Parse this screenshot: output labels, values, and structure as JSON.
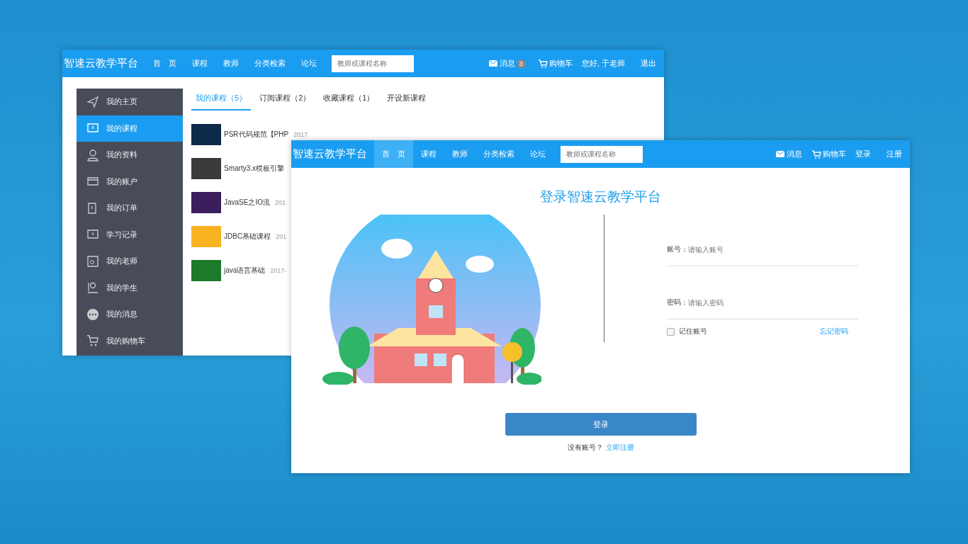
{
  "back_window": {
    "logo": "智速云教学平台",
    "nav": [
      {
        "label": "首　页",
        "selected": false
      },
      {
        "label": "课程",
        "selected": false
      },
      {
        "label": "教师",
        "selected": false
      },
      {
        "label": "分类检索",
        "selected": false
      },
      {
        "label": "论坛",
        "selected": false
      }
    ],
    "search": {
      "placeholder": "教师或课程名称"
    },
    "right": {
      "messages": "消息",
      "message_count": "3",
      "cart": "购物车",
      "greeting": "您好, 于老师",
      "logout": "退出"
    },
    "sidebar": [
      {
        "label": "我的主页",
        "selected": false
      },
      {
        "label": "我的课程",
        "selected": true
      },
      {
        "label": "我的资料",
        "selected": false
      },
      {
        "label": "我的账户",
        "selected": false
      },
      {
        "label": "我的订单",
        "selected": false
      },
      {
        "label": "学习记录",
        "selected": false
      },
      {
        "label": "我的老师",
        "selected": false
      },
      {
        "label": "我的学生",
        "selected": false
      },
      {
        "label": "我的消息",
        "selected": false
      },
      {
        "label": "我的购物车",
        "selected": false
      }
    ],
    "tabs": [
      {
        "label": "我的课程（5）",
        "selected": true
      },
      {
        "label": "订阅课程（2）",
        "selected": false
      },
      {
        "label": "收藏课程（1）",
        "selected": false
      },
      {
        "label": "开设新课程",
        "selected": false
      }
    ],
    "courses": [
      {
        "title": "PSR代码规范【PHP",
        "date": "2017"
      },
      {
        "title": "Smarty3.x模板引擎"
      },
      {
        "title": "JavaSE之IO流",
        "date": "201"
      },
      {
        "title": "JDBC基础课程",
        "date": "201"
      },
      {
        "title": "java语言基础",
        "date": "2017-"
      }
    ]
  },
  "front_window": {
    "logo": "智速云教学平台",
    "nav": [
      {
        "label": "首　页",
        "selected": true
      },
      {
        "label": "课程",
        "selected": false
      },
      {
        "label": "教师",
        "selected": false
      },
      {
        "label": "分类检索",
        "selected": false
      },
      {
        "label": "论坛",
        "selected": false
      }
    ],
    "search": {
      "placeholder": "教师或课程名称"
    },
    "right": {
      "messages": "消息",
      "cart": "购物车",
      "login": "登录",
      "register": "注册"
    },
    "title": "登录智速云教学平台",
    "account": {
      "label": "账号：",
      "placeholder": "请输入账号"
    },
    "password": {
      "label": "密码：",
      "placeholder": "请输入密码"
    },
    "remember": {
      "label": "记住账号",
      "checked": false
    },
    "forgot": "忘记密码",
    "submit": "登录",
    "no_account": "没有账号？",
    "register_link": "立即注册"
  }
}
